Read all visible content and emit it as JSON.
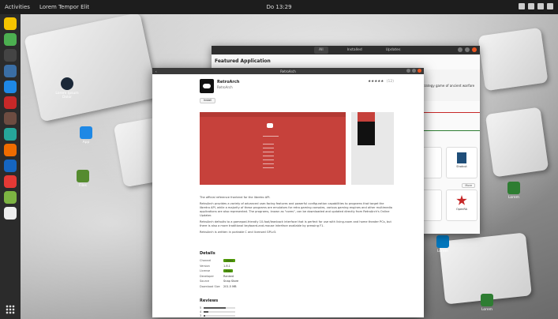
{
  "topbar": {
    "activities": "Activities",
    "app_menu": "Lorem Tempor Elit",
    "clock": "Do 13:29"
  },
  "desktop_icons": [
    {
      "label": "Lorem Ipsum Dolor"
    },
    {
      "label": "App"
    },
    {
      "label": "Files"
    },
    {
      "label": "Lorem"
    },
    {
      "label": "Lorem"
    },
    {
      "label": "Lorem"
    }
  ],
  "back_window": {
    "tabs": [
      "All",
      "Installed",
      "Updates"
    ],
    "featured_title": "Featured Application",
    "banner_text": "strategy game of ancient warfare",
    "tiles": [
      {
        "name": "Shotcut"
      },
      {
        "name": "OpenRA"
      },
      {
        "name": "More"
      }
    ]
  },
  "app_window": {
    "title": "RetroArch",
    "app_name": "RetroArch",
    "developer": "RetroArch",
    "rating_stars": "★★★★★",
    "rating_count": "(12)",
    "install_label": "Install",
    "description": [
      "The official reference frontend for the libretro API.",
      "RetroArch provides a variety of advanced user-facing features and powerful configuration capabilities to programs that target the libretro API, while a majority of these programs are emulators for retro gaming consoles, various gaming engines and other multimedia applications are also represented. The programs, known as \"cores\", can be downloaded and updated directly from RetroArch's Online Updater.",
      "RetroArch defaults to a gamepad-friendly 10-foot/leanback interface that is perfect for use with living-room and home theater PCs, but there is also a more traditional keyboard-and-mouse interface available by pressing F1.",
      "RetroArch is written in portable C and licensed GPLv3."
    ],
    "details_title": "Details",
    "details": [
      {
        "k": "Channel",
        "v": "stable",
        "badge": true
      },
      {
        "k": "Version",
        "v": "1.8.1",
        "badge": false
      },
      {
        "k": "License",
        "v": "Free",
        "badge": true
      },
      {
        "k": "Developer",
        "v": "Ranked",
        "badge": false
      },
      {
        "k": "Source",
        "v": "Snap Store",
        "badge": false
      },
      {
        "k": "Download Size",
        "v": "201.5 MB",
        "badge": false
      }
    ],
    "reviews_title": "Reviews",
    "reviews": [
      {
        "label": "5",
        "fraction": 0.7
      },
      {
        "label": "4",
        "fraction": 0.15
      },
      {
        "label": "3",
        "fraction": 0.05
      },
      {
        "label": "2",
        "fraction": 0.03
      },
      {
        "label": "1",
        "fraction": 0.07
      }
    ]
  }
}
